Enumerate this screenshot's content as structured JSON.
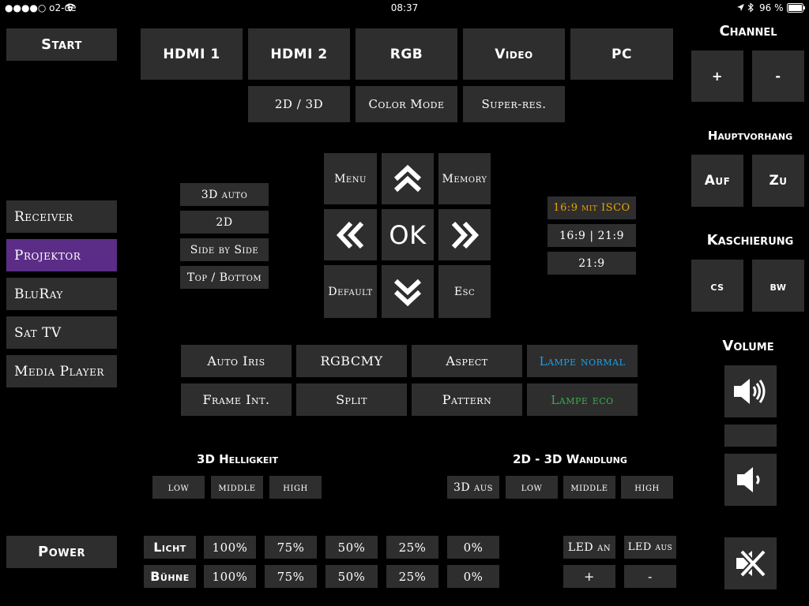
{
  "status_bar": {
    "carrier": "●●●●○ o2-de",
    "time": "08:37",
    "battery": "96 %"
  },
  "colors": {
    "background": "#000000",
    "button": "#2e2e2e",
    "active": "#5b2d86",
    "orange": "#e8a400",
    "blue": "#1ea0e6",
    "green": "#35b04a"
  },
  "left": {
    "start": "Start",
    "devices": [
      "Receiver",
      "Projektor",
      "BluRay",
      "Sat TV",
      "Media Player"
    ],
    "active_device": "Projektor",
    "power": "Power"
  },
  "inputs": {
    "top": [
      "HDMI 1",
      "HDMI 2",
      "RGB",
      "Video",
      "PC"
    ],
    "second": [
      "2D / 3D",
      "Color Mode",
      "Super-res."
    ]
  },
  "three_d_modes": [
    "3D auto",
    "2D",
    "Side by Side",
    "Top / Bottom"
  ],
  "dpad": {
    "menu": "Menu",
    "memory": "Memory",
    "ok": "OK",
    "default": "Default",
    "esc": "Esc",
    "icons": [
      "chevron-up-icon",
      "chevron-left-icon",
      "chevron-right-icon",
      "chevron-down-icon"
    ]
  },
  "aspect_modes": [
    "16:9 mit ISCO",
    "16:9 | 21:9",
    "21:9"
  ],
  "functions": {
    "row1": [
      "Auto Iris",
      "RGBCMY",
      "Aspect",
      "Lampe normal"
    ],
    "row2": [
      "Frame Int.",
      "Split",
      "Pattern",
      "Lampe eco"
    ]
  },
  "helligkeit": {
    "title": "3D Helligkeit",
    "options": [
      "low",
      "middle",
      "high"
    ]
  },
  "wandlung": {
    "title": "2D - 3D Wandlung",
    "options": [
      "3D aus",
      "low",
      "middle",
      "high"
    ]
  },
  "licht": {
    "label": "Licht",
    "levels": [
      "100%",
      "75%",
      "50%",
      "25%",
      "0%"
    ]
  },
  "buehne": {
    "label": "Bühne",
    "levels": [
      "100%",
      "75%",
      "50%",
      "25%",
      "0%"
    ]
  },
  "led": {
    "on": "LED an",
    "off": "LED aus",
    "plus": "+",
    "minus": "-"
  },
  "right": {
    "channel": {
      "title": "Channel",
      "plus": "+",
      "minus": "-"
    },
    "hauptvorhang": {
      "title": "Hauptvorhang",
      "auf": "Auf",
      "zu": "Zu"
    },
    "kaschierung": {
      "title": "Kaschierung",
      "cs": "cs",
      "bw": "bw"
    },
    "volume": {
      "title": "Volume",
      "icons": [
        "volume-up-icon",
        "volume-down-icon",
        "mute-icon"
      ]
    }
  }
}
